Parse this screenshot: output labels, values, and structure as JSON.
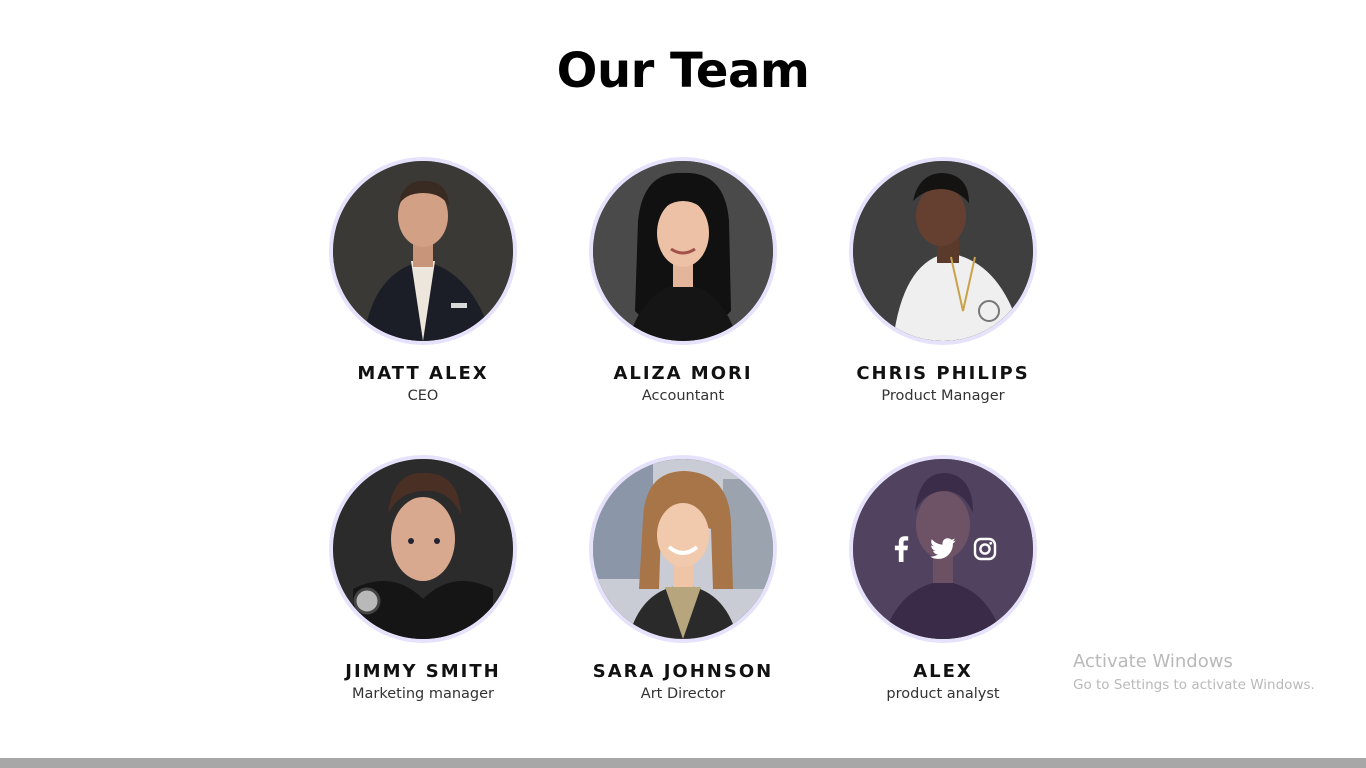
{
  "page": {
    "title": "Our Team"
  },
  "team": [
    {
      "name": "MATT ALEX",
      "role": "CEO"
    },
    {
      "name": "ALIZA MORI",
      "role": "Accountant"
    },
    {
      "name": "CHRIS PHILIPS",
      "role": "Product Manager"
    },
    {
      "name": "JIMMY SMITH",
      "role": "Marketing manager"
    },
    {
      "name": "SARA JOHNSON",
      "role": "Art Director"
    },
    {
      "name": "ALEX",
      "role": "product analyst",
      "social_icons": [
        "facebook-icon",
        "twitter-icon",
        "instagram-icon"
      ]
    }
  ],
  "watermark": {
    "title": "Activate Windows",
    "subtitle": "Go to Settings to activate Windows."
  },
  "colors": {
    "avatar_ring": "#e6e2fb",
    "overlay": "#48345c",
    "bottom_bar": "#a7a7a7"
  }
}
